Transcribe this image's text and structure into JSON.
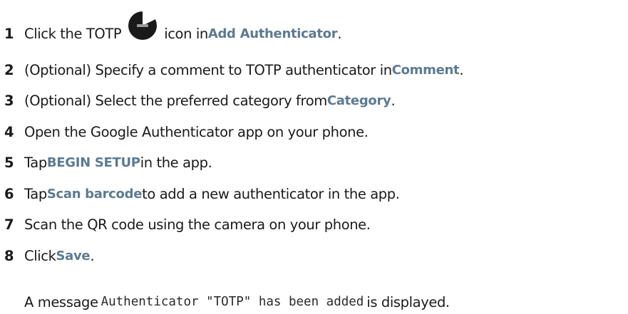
{
  "steps": [
    {
      "number": "1",
      "parts": [
        {
          "t": "Click the TOTP"
        },
        {
          "icon": "totp-icon"
        },
        {
          "t": "icon in "
        },
        {
          "ui": "Add Authenticator"
        },
        {
          "t": "."
        }
      ]
    },
    {
      "number": "2",
      "parts": [
        {
          "t": "(Optional) Specify a comment to TOTP authenticator in "
        },
        {
          "ui": "Comment"
        },
        {
          "t": "."
        }
      ]
    },
    {
      "number": "3",
      "parts": [
        {
          "t": "(Optional) Select the preferred category from "
        },
        {
          "ui": "Category"
        },
        {
          "t": "."
        }
      ]
    },
    {
      "number": "4",
      "parts": [
        {
          "t": "Open the Google Authenticator app on your phone."
        }
      ]
    },
    {
      "number": "5",
      "parts": [
        {
          "t": "Tap "
        },
        {
          "ui": "BEGIN SETUP"
        },
        {
          "t": " in the app."
        }
      ]
    },
    {
      "number": "6",
      "parts": [
        {
          "t": "Tap "
        },
        {
          "ui": "Scan barcode"
        },
        {
          "t": " to add a new authenticator in the app."
        }
      ]
    },
    {
      "number": "7",
      "parts": [
        {
          "t": "Scan the QR code using the camera on your phone."
        }
      ]
    },
    {
      "number": "8",
      "parts": [
        {
          "t": "Click "
        },
        {
          "ui": "Save"
        },
        {
          "t": "."
        }
      ]
    }
  ],
  "result": {
    "prefix": "A message",
    "code": "Authenticator \"TOTP\" has been added",
    "suffix": "is displayed."
  },
  "colors": {
    "text": "#1a1a1a",
    "ui_label": "#5d7a90",
    "icon_fill": "#1a1a1a"
  }
}
